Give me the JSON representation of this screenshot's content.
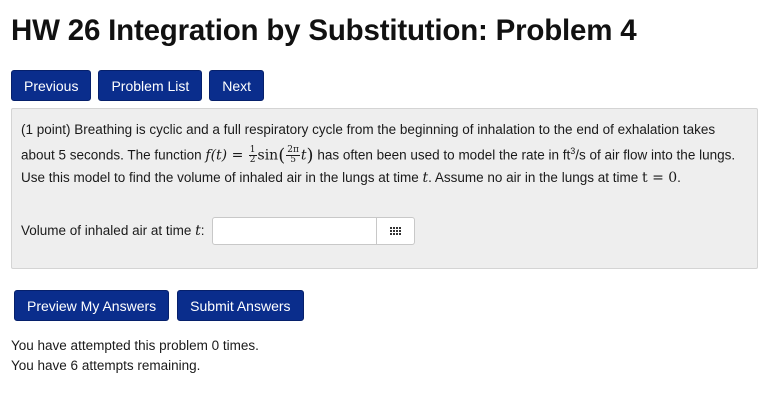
{
  "page_title": "HW 26 Integration by Substitution: Problem 4",
  "nav": {
    "previous": "Previous",
    "problem_list": "Problem List",
    "next": "Next"
  },
  "problem": {
    "points": "(1 point)",
    "text_1": "Breathing is cyclic and a full respiratory cycle from the beginning of inhalation to the end of exhalation takes about 5 seconds. The function",
    "math_f": "f(t) = ",
    "frac1_num": "1",
    "frac1_den": "2",
    "sin": "sin",
    "frac2_num": "2π",
    "frac2_den": "5",
    "math_t": "t",
    "text_2": "has often been used to model the rate in ft",
    "unit_exp": "3",
    "text_3": "/s of air flow into the lungs. Use this model to find the volume of inhaled air in the lungs at time",
    "text_4": ". Assume no air in the lungs at time",
    "math_t0": "t = 0",
    "text_5": "."
  },
  "answer": {
    "label": "Volume of inhaled air at time",
    "label_var": "t",
    "label_colon": ":",
    "value": "",
    "equation_editor_icon": "grid-icon"
  },
  "actions": {
    "preview": "Preview My Answers",
    "submit": "Submit Answers"
  },
  "status": {
    "attempted": "You have attempted this problem 0 times.",
    "remaining": "You have 6 attempts remaining."
  },
  "colors": {
    "button_bg": "#0a2d8c",
    "button_text": "#ffffff",
    "panel_bg": "#eeeeee"
  }
}
